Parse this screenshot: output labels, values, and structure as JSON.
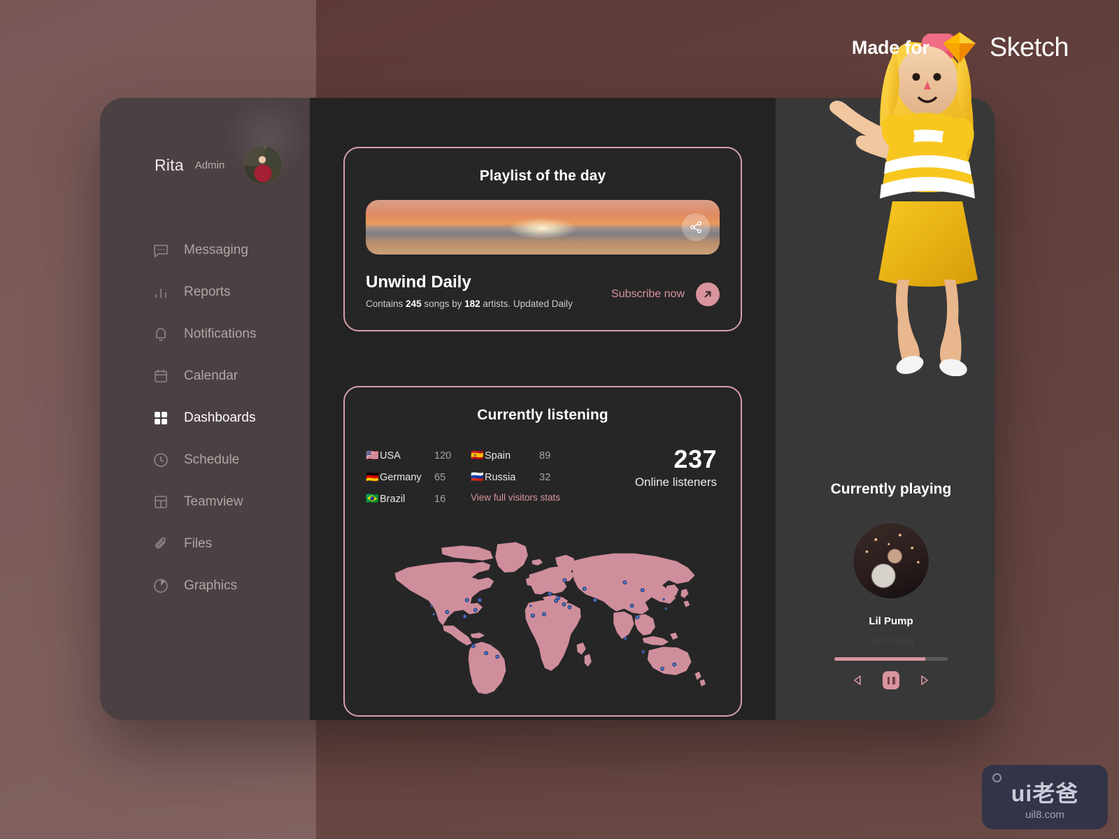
{
  "branding": {
    "made_for": "Made for",
    "sketch": "Sketch",
    "sketch_icon": "sketch-diamond-icon"
  },
  "watermark": {
    "main": "ui老爸",
    "sub": "uil8.com"
  },
  "sidebar": {
    "user": {
      "name": "Rita",
      "role": "Admin",
      "avatar": "user-avatar"
    },
    "items": [
      {
        "label": "Messaging",
        "icon": "message-icon",
        "active": false
      },
      {
        "label": "Reports",
        "icon": "bar-chart-icon",
        "active": false
      },
      {
        "label": "Notifications",
        "icon": "bell-icon",
        "active": false
      },
      {
        "label": "Calendar",
        "icon": "calendar-icon",
        "active": false
      },
      {
        "label": "Dashboards",
        "icon": "grid-icon",
        "active": true
      },
      {
        "label": "Schedule",
        "icon": "clock-icon",
        "active": false
      },
      {
        "label": "Teamview",
        "icon": "layout-icon",
        "active": false
      },
      {
        "label": "Files",
        "icon": "paperclip-icon",
        "active": false
      },
      {
        "label": "Graphics",
        "icon": "pie-chart-icon",
        "active": false
      }
    ]
  },
  "playlist_card": {
    "title": "Playlist of the day",
    "cover_alt": "sunset-over-ocean-cover",
    "share_icon": "share-icon",
    "name": "Unwind Daily",
    "meta_prefix": "Contains ",
    "songs": "245",
    "meta_mid": " songs by ",
    "artists": "182",
    "meta_suffix": " artists. Updated Daily",
    "subscribe_label": "Subscribe now",
    "subscribe_icon": "arrow-up-right-icon"
  },
  "listening_card": {
    "title": "Currently listening",
    "countries_left": [
      {
        "flag": "🇺🇸",
        "name": "USA",
        "count": "120"
      },
      {
        "flag": "🇩🇪",
        "name": "Germany",
        "count": "65"
      },
      {
        "flag": "🇧🇷",
        "name": "Brazil",
        "count": "16"
      }
    ],
    "countries_right": [
      {
        "flag": "🇪🇸",
        "name": "Spain",
        "count": "89"
      },
      {
        "flag": "🇷🇺",
        "name": "Russia",
        "count": "32"
      }
    ],
    "view_link": "View full visitors stats",
    "online_number": "237",
    "online_label": "Online listeners",
    "map_alt": "world-map-with-listener-markers"
  },
  "now_playing": {
    "title": "Currently playing",
    "artwork_alt": "album-artwork",
    "artist": "Lil Pump",
    "track": "Gucci gang",
    "progress_percent": 80,
    "prev_icon": "previous-icon",
    "pause_icon": "pause-icon",
    "next_icon": "next-icon"
  },
  "decorations": {
    "character": "3d-girl-character",
    "joystick": "3d-joystick"
  },
  "colors": {
    "accent_pink": "#d9949e",
    "card_border": "#d9a0a8",
    "panel_dark": "#232323",
    "panel_right": "#383838",
    "sidebar": "#4b4042",
    "backdrop": "#5d3a38"
  }
}
